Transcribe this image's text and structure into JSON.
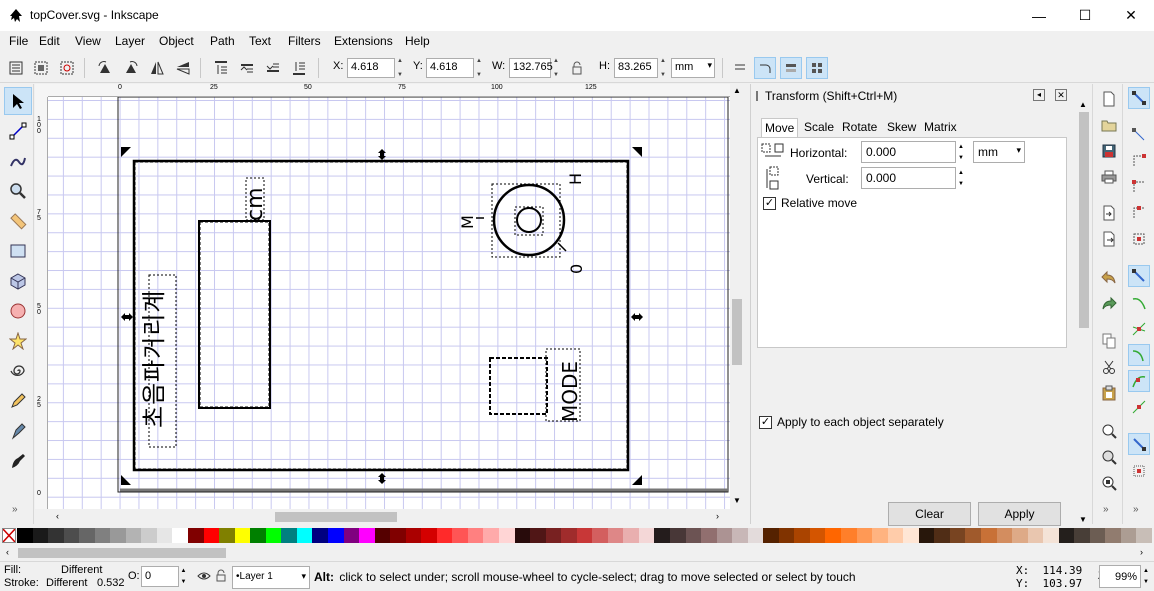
{
  "window": {
    "title": "topCover.svg - Inkscape",
    "minimize": "—",
    "maximize": "☐",
    "close": "✕"
  },
  "menu": [
    "File",
    "Edit",
    "View",
    "Layer",
    "Object",
    "Path",
    "Text",
    "Filters",
    "Extensions",
    "Help"
  ],
  "toolbar": {
    "x_label": "X:",
    "x_value": "4.618",
    "y_label": "Y:",
    "y_value": "4.618",
    "w_label": "W:",
    "w_value": "132.765",
    "h_label": "H:",
    "h_value": "83.265",
    "unit": "mm"
  },
  "ruler": {
    "h_ticks": [
      "0",
      "25",
      "50",
      "75",
      "100",
      "125"
    ],
    "v_ticks": [
      "1 0 0",
      "7 5",
      "5 0",
      "2 5",
      "0"
    ]
  },
  "canvas": {
    "korean_label": "초음파거리계",
    "cm_label": "cm",
    "mode_label": "MODE",
    "knob_letters": [
      "M",
      "H",
      "0"
    ]
  },
  "dock": {
    "panel_title": "Transform (Shift+Ctrl+M)",
    "tabs": [
      "Move",
      "Scale",
      "Rotate",
      "Skew",
      "Matrix"
    ],
    "active_tab": "Move",
    "horizontal_label": "Horizontal:",
    "horizontal_value": "0.000",
    "vertical_label": "Vertical:",
    "vertical_value": "0.000",
    "unit": "mm",
    "relative_move_label": "Relative move",
    "relative_move_checked": true,
    "apply_each_label": "Apply to each object separately",
    "apply_each_checked": true,
    "clear_label": "Clear",
    "apply_label": "Apply"
  },
  "palette_colors": [
    "#000000",
    "#1a1a1a",
    "#333333",
    "#4d4d4d",
    "#666666",
    "#808080",
    "#999999",
    "#b3b3b3",
    "#cccccc",
    "#e6e6e6",
    "#ffffff",
    "#800000",
    "#ff0000",
    "#808000",
    "#ffff00",
    "#008000",
    "#00ff00",
    "#008080",
    "#00ffff",
    "#000080",
    "#0000ff",
    "#800080",
    "#ff00ff",
    "#550000",
    "#800000",
    "#aa0000",
    "#d40000",
    "#ff2a2a",
    "#ff5555",
    "#ff8080",
    "#ffaaaa",
    "#ffd5d5",
    "#280b0b",
    "#501616",
    "#782121",
    "#a02c2c",
    "#c83737",
    "#d35f5f",
    "#de8787",
    "#e9afaf",
    "#f4d7d7",
    "#241c1c",
    "#483737",
    "#6c5353",
    "#916f6f",
    "#ac9393",
    "#c8b7b7",
    "#e3dbdb",
    "#552200",
    "#803300",
    "#aa4400",
    "#d45500",
    "#ff6600",
    "#ff7f2a",
    "#ff9955",
    "#ffb380",
    "#ffccaa",
    "#ffe6d5",
    "#28170b",
    "#502d16",
    "#784421",
    "#a05a2c",
    "#c87137",
    "#d38d5f",
    "#deaa87",
    "#e9c6af",
    "#f4e3d7",
    "#241f1c",
    "#483e37",
    "#6c5d53",
    "#917c6f",
    "#ac9d93",
    "#c8beb7"
  ],
  "status": {
    "fill_label": "Fill:",
    "fill_value": "Different",
    "stroke_label": "Stroke:",
    "stroke_value": "Different",
    "stroke_width": "0.532",
    "opacity_label": "O:",
    "opacity_value": "0",
    "layer": "•Layer 1",
    "message_bold": "Alt:",
    "message": " click to select under; scroll mouse-wheel to cycle-select; drag to move selected or select by touch",
    "x_coord": "X:  114.39",
    "y_coord": "Y:  103.97",
    "zoom_label": "Z:",
    "zoom_value": "99%"
  }
}
